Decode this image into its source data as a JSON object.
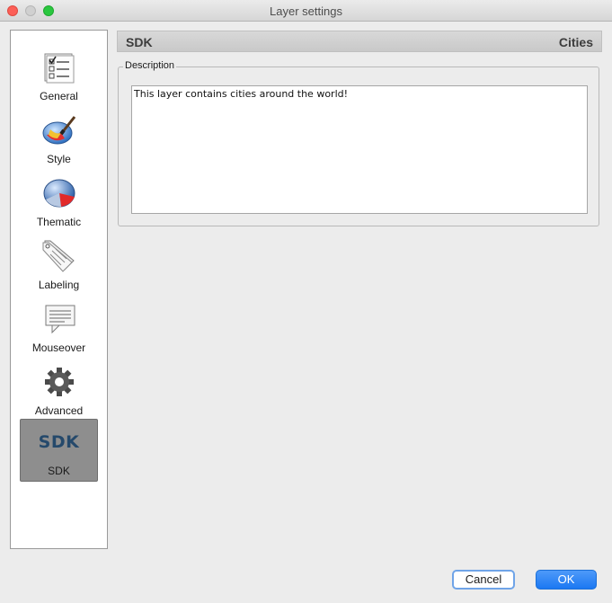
{
  "window": {
    "title": "Layer settings"
  },
  "sidebar": {
    "items": [
      {
        "label": "General",
        "icon": "checklist-icon"
      },
      {
        "label": "Style",
        "icon": "paint-globe-icon"
      },
      {
        "label": "Thematic",
        "icon": "thematic-sphere-icon"
      },
      {
        "label": "Labeling",
        "icon": "label-tag-icon"
      },
      {
        "label": "Mouseover",
        "icon": "tooltip-note-icon"
      },
      {
        "label": "Advanced",
        "icon": "gear-icon"
      },
      {
        "label": "SDK",
        "icon": "sdk-icon",
        "glyph": "SDK",
        "selected": true
      }
    ]
  },
  "header": {
    "left": "SDK",
    "right": "Cities"
  },
  "description": {
    "legend": "Description",
    "text": "This layer contains cities around the world!"
  },
  "buttons": {
    "cancel": "Cancel",
    "ok": "OK"
  },
  "colors": {
    "accent": "#1b78f2",
    "selected_item": "#8e8e8e"
  }
}
